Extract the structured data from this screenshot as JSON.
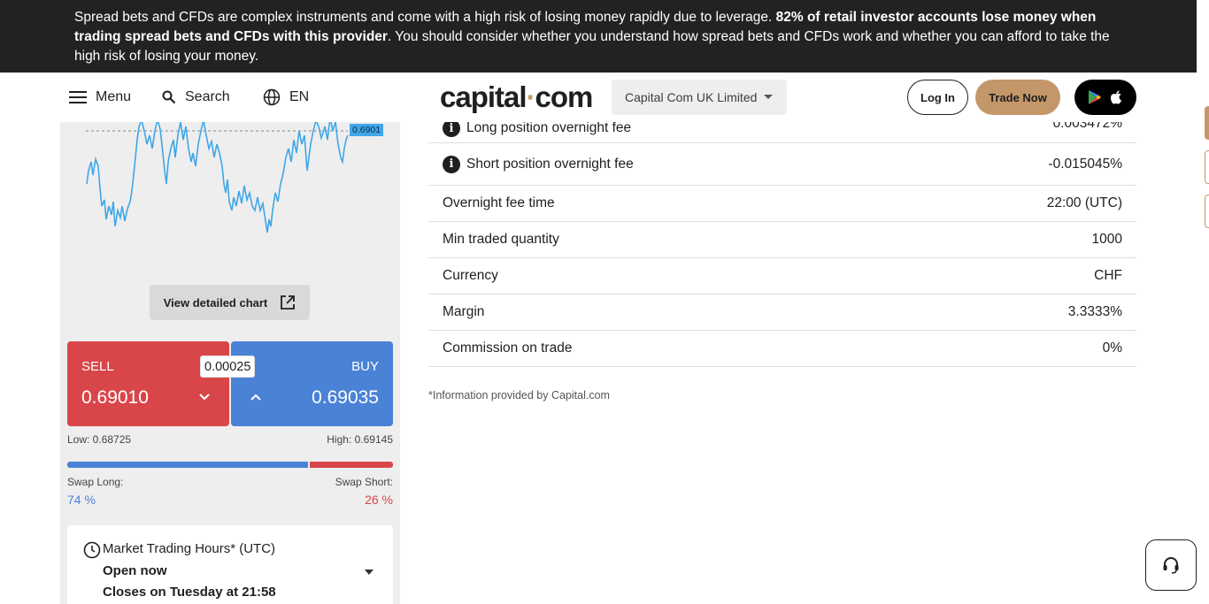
{
  "banner": {
    "text_1": "Spread bets and CFDs are complex instruments and come with a high risk of losing money rapidly due to leverage. ",
    "text_bold": "82% of retail investor accounts lose money when trading spread bets and CFDs with this provider",
    "text_2": ". You should consider whether you understand how spread bets and CFDs work and whether you can afford to take the high risk of losing your money."
  },
  "header": {
    "menu_label": "Menu",
    "search_label": "Search",
    "lang_label": "EN",
    "logo_left": "capital",
    "logo_dot": "·",
    "logo_right": "com",
    "entity_selected": "Capital Com UK Limited",
    "login_label": "Log In",
    "trade_label": "Trade Now"
  },
  "chart_panel": {
    "current_price_tag": "0.6901",
    "view_chart_label": "View detailed chart"
  },
  "trade": {
    "sell_label": "SELL",
    "sell_price": "0.69010",
    "buy_label": "BUY",
    "buy_price": "0.69035",
    "spread": "0.00025",
    "low": "Low: 0.68725",
    "high": "High: 0.69145",
    "swap_long_label": "Swap Long:",
    "swap_long_value": "74 %",
    "swap_short_label": "Swap Short:",
    "swap_short_value": "26 %",
    "long_fraction": 0.74
  },
  "hours": {
    "title": "Market Trading Hours* (UTC)",
    "status": "Open now",
    "closes": "Closes on Tuesday at 21:58"
  },
  "details": {
    "rows": [
      {
        "label": "Long position overnight fee",
        "value": "0.003472%"
      },
      {
        "label": "Short position overnight fee",
        "value": "-0.015045%"
      },
      {
        "label": "Overnight fee time",
        "value": "22:00 (UTC)"
      },
      {
        "label": "Min traded quantity",
        "value": "1000"
      },
      {
        "label": "Currency",
        "value": "CHF"
      },
      {
        "label": "Margin",
        "value": "3.3333%"
      },
      {
        "label": "Commission on trade",
        "value": "0%"
      }
    ],
    "footnote": "*Information provided by Capital.com"
  },
  "colors": {
    "sell": "#d9464a",
    "buy": "#4a82d6",
    "brand": "#c4976a",
    "banner_bg": "#222222"
  }
}
